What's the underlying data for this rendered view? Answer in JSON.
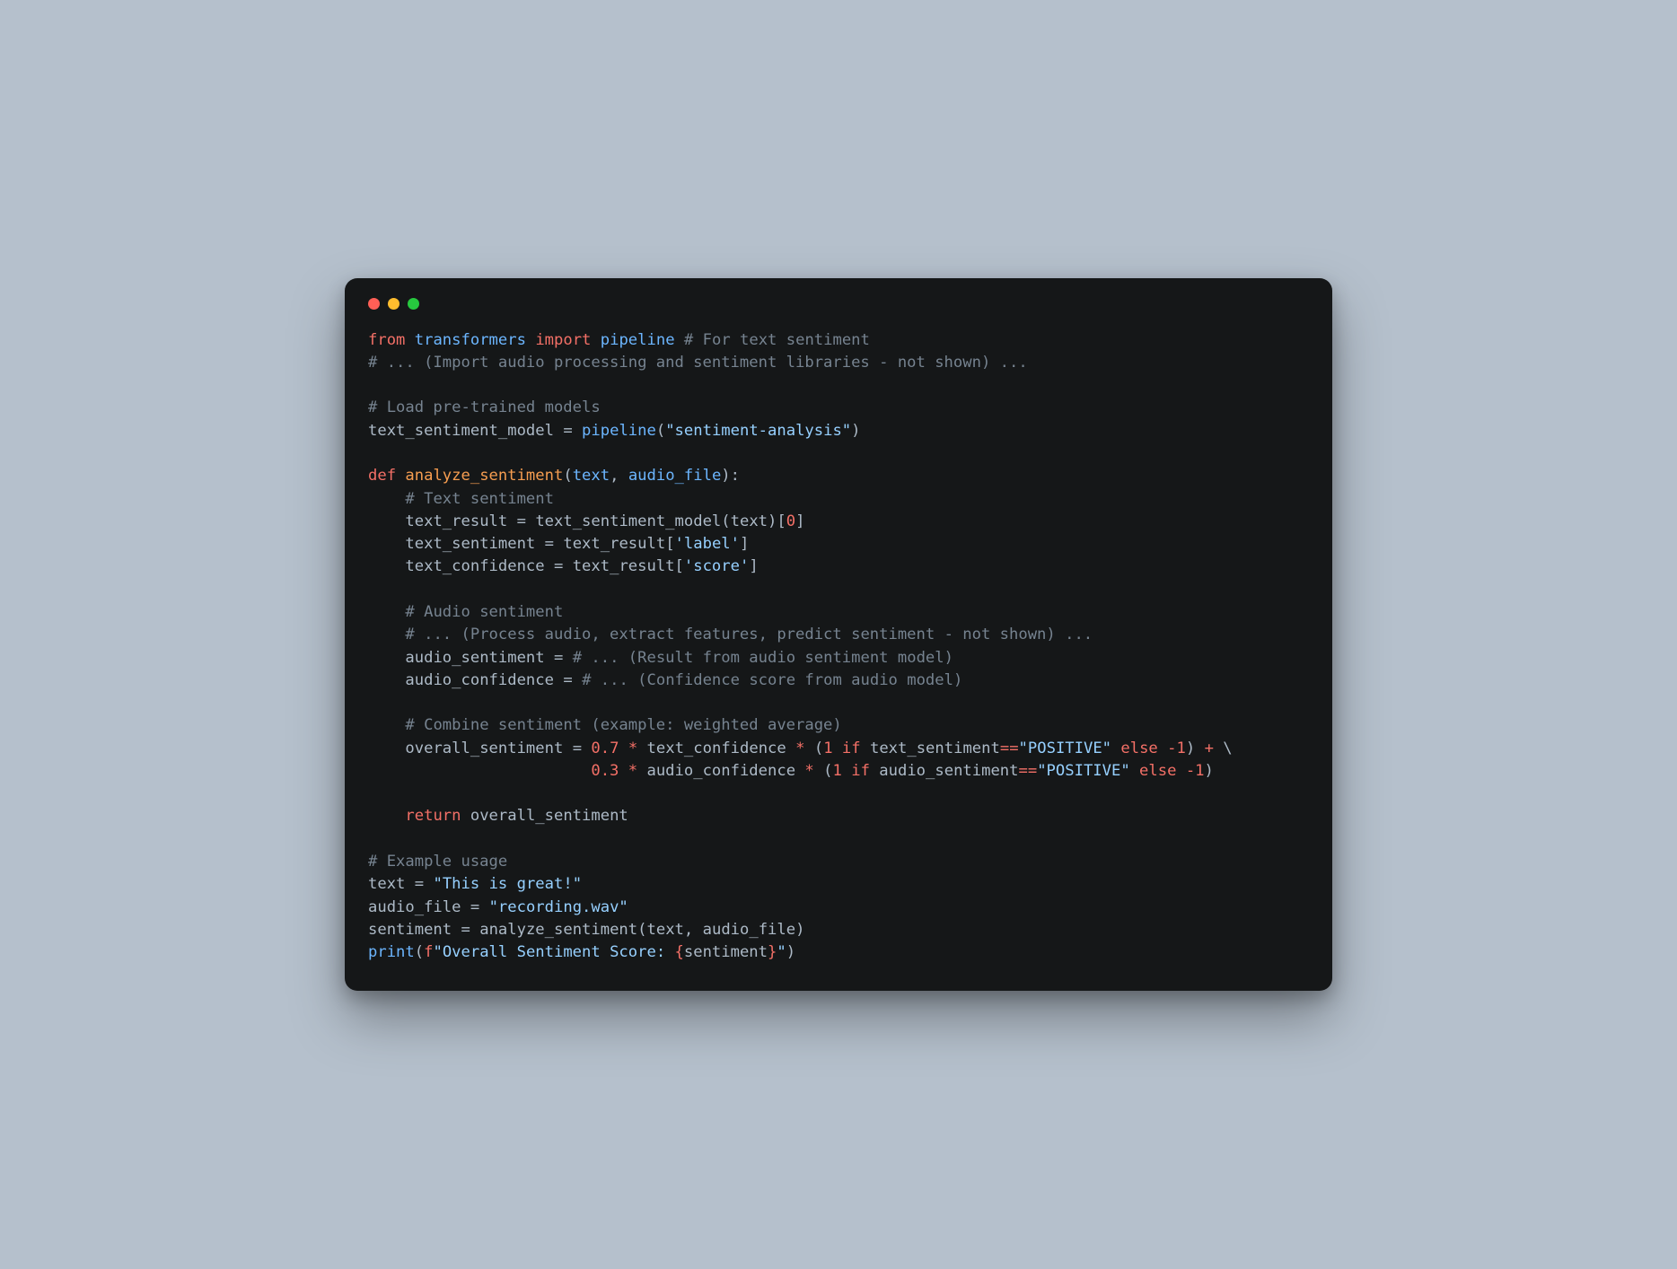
{
  "window": {
    "traffic_lights": [
      "close",
      "minimize",
      "zoom"
    ]
  },
  "code": {
    "language": "python",
    "tokens": [
      [
        [
          "kw",
          "from"
        ],
        [
          "sp",
          " "
        ],
        [
          "mod",
          "transformers"
        ],
        [
          "sp",
          " "
        ],
        [
          "kw",
          "import"
        ],
        [
          "sp",
          " "
        ],
        [
          "mod",
          "pipeline"
        ],
        [
          "sp",
          " "
        ],
        [
          "comm",
          "# For text sentiment"
        ]
      ],
      [
        [
          "comm",
          "# ... (Import audio processing and sentiment libraries - not shown) ..."
        ]
      ],
      [],
      [
        [
          "comm",
          "# Load pre-trained models"
        ]
      ],
      [
        [
          "id",
          "text_sentiment_model"
        ],
        [
          "sp",
          " "
        ],
        [
          "assign",
          "="
        ],
        [
          "sp",
          " "
        ],
        [
          "mod",
          "pipeline"
        ],
        [
          "paren",
          "("
        ],
        [
          "str",
          "\"sentiment-analysis\""
        ],
        [
          "paren",
          ")"
        ]
      ],
      [],
      [
        [
          "kw",
          "def"
        ],
        [
          "sp",
          " "
        ],
        [
          "def",
          "analyze_sentiment"
        ],
        [
          "paren",
          "("
        ],
        [
          "param",
          "text"
        ],
        [
          "punct",
          ","
        ],
        [
          "sp",
          " "
        ],
        [
          "param",
          "audio_file"
        ],
        [
          "paren",
          ")"
        ],
        [
          "punct",
          ":"
        ]
      ],
      [
        [
          "sp",
          "    "
        ],
        [
          "comm",
          "# Text sentiment"
        ]
      ],
      [
        [
          "sp",
          "    "
        ],
        [
          "id",
          "text_result"
        ],
        [
          "sp",
          " "
        ],
        [
          "assign",
          "="
        ],
        [
          "sp",
          " "
        ],
        [
          "id",
          "text_sentiment_model"
        ],
        [
          "paren",
          "("
        ],
        [
          "id",
          "text"
        ],
        [
          "paren",
          ")"
        ],
        [
          "paren",
          "["
        ],
        [
          "num",
          "0"
        ],
        [
          "paren",
          "]"
        ]
      ],
      [
        [
          "sp",
          "    "
        ],
        [
          "id",
          "text_sentiment"
        ],
        [
          "sp",
          " "
        ],
        [
          "assign",
          "="
        ],
        [
          "sp",
          " "
        ],
        [
          "id",
          "text_result"
        ],
        [
          "paren",
          "["
        ],
        [
          "str",
          "'label'"
        ],
        [
          "paren",
          "]"
        ]
      ],
      [
        [
          "sp",
          "    "
        ],
        [
          "id",
          "text_confidence"
        ],
        [
          "sp",
          " "
        ],
        [
          "assign",
          "="
        ],
        [
          "sp",
          " "
        ],
        [
          "id",
          "text_result"
        ],
        [
          "paren",
          "["
        ],
        [
          "str",
          "'score'"
        ],
        [
          "paren",
          "]"
        ]
      ],
      [],
      [
        [
          "sp",
          "    "
        ],
        [
          "comm",
          "# Audio sentiment"
        ]
      ],
      [
        [
          "sp",
          "    "
        ],
        [
          "comm",
          "# ... (Process audio, extract features, predict sentiment - not shown) ..."
        ]
      ],
      [
        [
          "sp",
          "    "
        ],
        [
          "id",
          "audio_sentiment"
        ],
        [
          "sp",
          " "
        ],
        [
          "assign",
          "="
        ],
        [
          "sp",
          " "
        ],
        [
          "comm",
          "# ... (Result from audio sentiment model)"
        ]
      ],
      [
        [
          "sp",
          "    "
        ],
        [
          "id",
          "audio_confidence"
        ],
        [
          "sp",
          " "
        ],
        [
          "assign",
          "="
        ],
        [
          "sp",
          " "
        ],
        [
          "comm",
          "# ... (Confidence score from audio model)"
        ]
      ],
      [],
      [
        [
          "sp",
          "    "
        ],
        [
          "comm",
          "# Combine sentiment (example: weighted average)"
        ]
      ],
      [
        [
          "sp",
          "    "
        ],
        [
          "id",
          "overall_sentiment"
        ],
        [
          "sp",
          " "
        ],
        [
          "assign",
          "="
        ],
        [
          "sp",
          " "
        ],
        [
          "num",
          "0.7"
        ],
        [
          "sp",
          " "
        ],
        [
          "op",
          "*"
        ],
        [
          "sp",
          " "
        ],
        [
          "id",
          "text_confidence"
        ],
        [
          "sp",
          " "
        ],
        [
          "op",
          "*"
        ],
        [
          "sp",
          " "
        ],
        [
          "paren",
          "("
        ],
        [
          "num",
          "1"
        ],
        [
          "sp",
          " "
        ],
        [
          "kw",
          "if"
        ],
        [
          "sp",
          " "
        ],
        [
          "id",
          "text_sentiment"
        ],
        [
          "op",
          "=="
        ],
        [
          "str",
          "\"POSITIVE\""
        ],
        [
          "sp",
          " "
        ],
        [
          "kw",
          "else"
        ],
        [
          "sp",
          " "
        ],
        [
          "num",
          "-1"
        ],
        [
          "paren",
          ")"
        ],
        [
          "sp",
          " "
        ],
        [
          "op",
          "+"
        ],
        [
          "sp",
          " "
        ],
        [
          "id",
          "\\"
        ]
      ],
      [
        [
          "sp",
          "                        "
        ],
        [
          "num",
          "0.3"
        ],
        [
          "sp",
          " "
        ],
        [
          "op",
          "*"
        ],
        [
          "sp",
          " "
        ],
        [
          "id",
          "audio_confidence"
        ],
        [
          "sp",
          " "
        ],
        [
          "op",
          "*"
        ],
        [
          "sp",
          " "
        ],
        [
          "paren",
          "("
        ],
        [
          "num",
          "1"
        ],
        [
          "sp",
          " "
        ],
        [
          "kw",
          "if"
        ],
        [
          "sp",
          " "
        ],
        [
          "id",
          "audio_sentiment"
        ],
        [
          "op",
          "=="
        ],
        [
          "str",
          "\"POSITIVE\""
        ],
        [
          "sp",
          " "
        ],
        [
          "kw",
          "else"
        ],
        [
          "sp",
          " "
        ],
        [
          "num",
          "-1"
        ],
        [
          "paren",
          ")"
        ]
      ],
      [],
      [
        [
          "sp",
          "    "
        ],
        [
          "kw",
          "return"
        ],
        [
          "sp",
          " "
        ],
        [
          "id",
          "overall_sentiment"
        ]
      ],
      [],
      [
        [
          "comm",
          "# Example usage"
        ]
      ],
      [
        [
          "id",
          "text"
        ],
        [
          "sp",
          " "
        ],
        [
          "assign",
          "="
        ],
        [
          "sp",
          " "
        ],
        [
          "str",
          "\"This is great!\""
        ]
      ],
      [
        [
          "id",
          "audio_file"
        ],
        [
          "sp",
          " "
        ],
        [
          "assign",
          "="
        ],
        [
          "sp",
          " "
        ],
        [
          "str",
          "\"recording.wav\""
        ]
      ],
      [
        [
          "id",
          "sentiment"
        ],
        [
          "sp",
          " "
        ],
        [
          "assign",
          "="
        ],
        [
          "sp",
          " "
        ],
        [
          "id",
          "analyze_sentiment"
        ],
        [
          "paren",
          "("
        ],
        [
          "id",
          "text"
        ],
        [
          "punct",
          ","
        ],
        [
          "sp",
          " "
        ],
        [
          "id",
          "audio_file"
        ],
        [
          "paren",
          ")"
        ]
      ],
      [
        [
          "mod",
          "print"
        ],
        [
          "paren",
          "("
        ],
        [
          "kw",
          "f"
        ],
        [
          "str",
          "\"Overall Sentiment Score: "
        ],
        [
          "brace",
          "{"
        ],
        [
          "id",
          "sentiment"
        ],
        [
          "brace",
          "}"
        ],
        [
          "str",
          "\""
        ],
        [
          "paren",
          ")"
        ]
      ]
    ]
  }
}
